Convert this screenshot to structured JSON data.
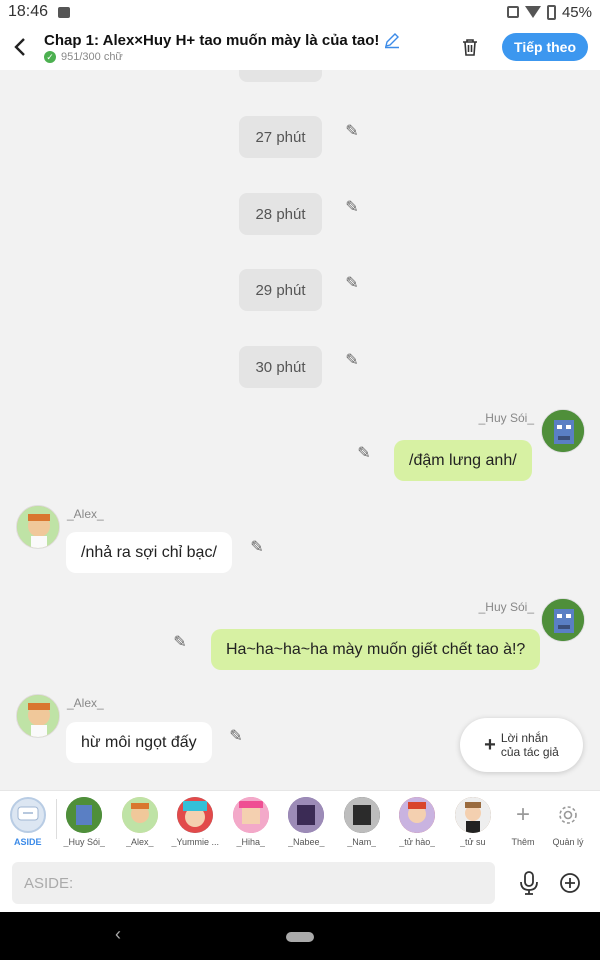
{
  "status": {
    "time": "18:46",
    "battery": "45%"
  },
  "header": {
    "title": "Chap 1: Alex×Huy H+ tao muốn mày là của tao!",
    "word_count": "951/300 chữ",
    "follow_label": "Tiếp theo"
  },
  "chat": {
    "time_pills": [
      "27 phút",
      "28 phút",
      "29 phút",
      "30 phút"
    ],
    "messages": [
      {
        "sender": "_Huy Sói_",
        "text": "/đậm lưng anh/"
      },
      {
        "sender": "_Alex_",
        "text": "/nhả ra sợi chỉ bạc/"
      },
      {
        "sender": "_Huy Sói_",
        "text": "Ha~ha~ha~ha mày muốn giết chết tao à!?"
      },
      {
        "sender": "_Alex_",
        "text": "hừ môi ngọt đấy"
      }
    ],
    "fab_label_line1": "Lời nhắn",
    "fab_label_line2": "của tác giả"
  },
  "characters": {
    "items": [
      {
        "label": "ASIDE",
        "color": "#dce6f2"
      },
      {
        "label": "_Huy Sói_",
        "color": "#3a7d3a"
      },
      {
        "label": "_Alex_",
        "color": "#e8b88a"
      },
      {
        "label": "_Yummie ...",
        "color": "#34c0d8"
      },
      {
        "label": "_Hiha_",
        "color": "#ef6fa8"
      },
      {
        "label": "_Nabee_",
        "color": "#6a4c93"
      },
      {
        "label": "_Nam_",
        "color": "#3b3b3b"
      },
      {
        "label": "_tử hào_",
        "color": "#d9442b"
      },
      {
        "label": "_tử su",
        "color": "#9a6b3f"
      }
    ],
    "more_label": "Thêm",
    "manage_label": "Quản lý"
  },
  "input": {
    "placeholder": "ASIDE:"
  }
}
